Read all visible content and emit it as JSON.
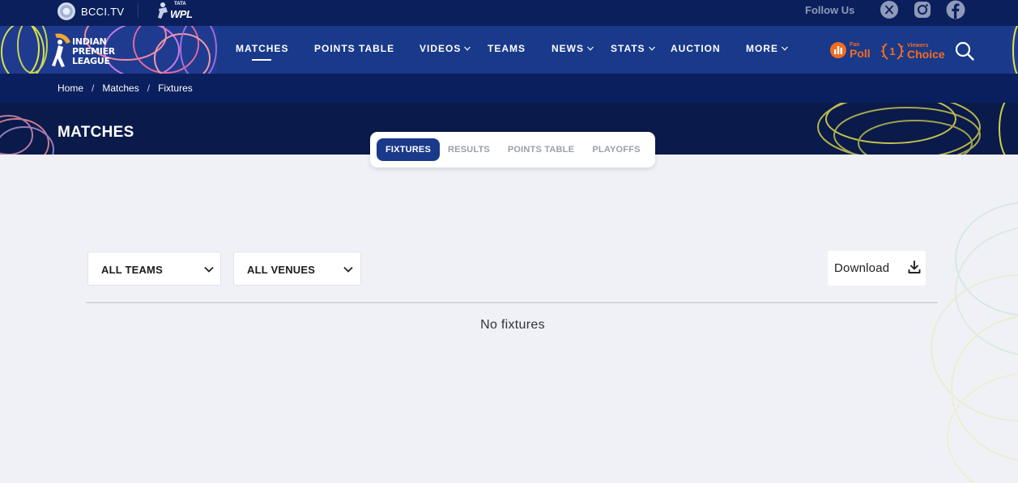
{
  "topbar": {
    "bcci_label": "BCCI.TV",
    "wpl_tata": "TATA",
    "wpl_label": "WPL",
    "follow_label": "Follow Us",
    "social_icons": [
      "x-icon",
      "instagram-icon",
      "facebook-icon"
    ]
  },
  "logo": {
    "line1": "INDIAN",
    "line2": "PREMIER",
    "line3": "LEAGUE"
  },
  "nav": {
    "items": [
      {
        "label": "MATCHES",
        "active": true
      },
      {
        "label": "POINTS TABLE"
      },
      {
        "label": "VIDEOS",
        "has_dropdown": true
      },
      {
        "label": "TEAMS"
      },
      {
        "label": "NEWS",
        "has_dropdown": true
      },
      {
        "label": "STATS",
        "has_dropdown": true
      },
      {
        "label": "AUCTION"
      },
      {
        "label": "MORE",
        "has_dropdown": true
      }
    ],
    "fan_poll_small": "Fan",
    "fan_poll_big": "Poll",
    "viewers_small": "Viewers",
    "viewers_big": "Choice",
    "viewers_number": "1"
  },
  "breadcrumb": {
    "items": [
      "Home",
      "Matches",
      "Fixtures"
    ],
    "separator": "/"
  },
  "hero": {
    "title": "MATCHES"
  },
  "tabs": [
    {
      "label": "FIXTURES",
      "active": true
    },
    {
      "label": "RESULTS"
    },
    {
      "label": "POINTS TABLE"
    },
    {
      "label": "PLAYOFFS"
    }
  ],
  "filters": {
    "teams": "ALL TEAMS",
    "venues": "ALL VENUES"
  },
  "download": {
    "label": "Download"
  },
  "empty_state": "No fixtures",
  "colors": {
    "top_bar": "#0b1f5c",
    "nav_bar": "#19398a",
    "accent_orange": "#f36c21",
    "page_bg": "#f0f1f6"
  }
}
